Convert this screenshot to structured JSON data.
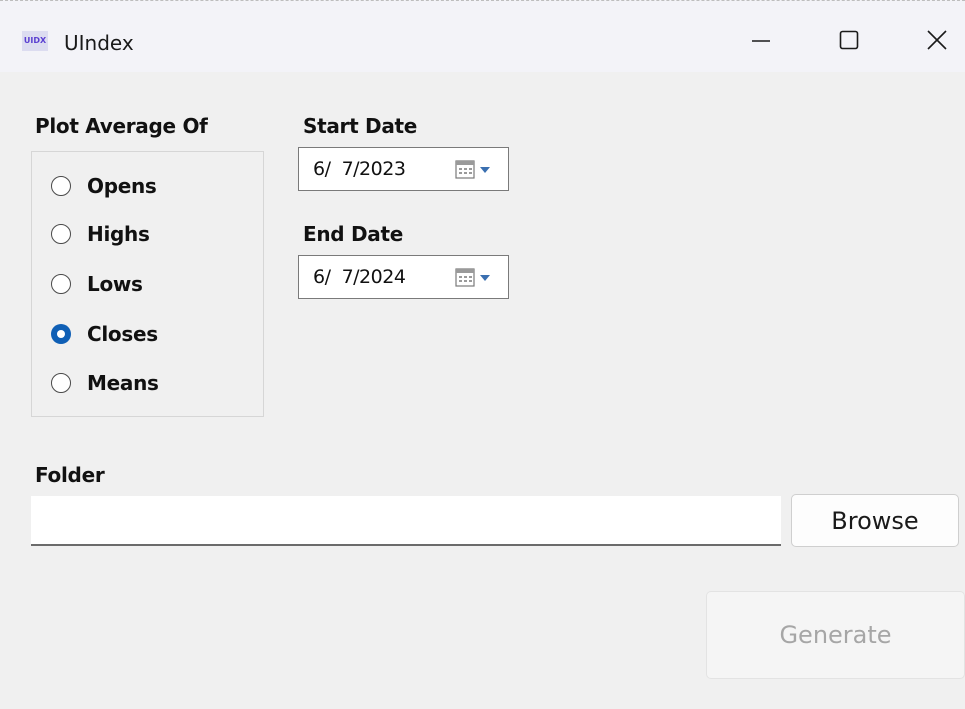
{
  "window": {
    "app_icon_text": "UIDX",
    "title": "UIndex",
    "icons": {
      "minimize": "minimize-icon",
      "maximize": "maximize-icon",
      "close": "close-icon"
    }
  },
  "plot_group": {
    "label": "Plot Average Of",
    "options": [
      {
        "label": "Opens",
        "checked": false
      },
      {
        "label": "Highs",
        "checked": false
      },
      {
        "label": "Lows",
        "checked": false
      },
      {
        "label": "Closes",
        "checked": true
      },
      {
        "label": "Means",
        "checked": false
      }
    ],
    "accent_color": "#0f5fb5"
  },
  "start_date": {
    "label": "Start Date",
    "value": "6/  7/2023"
  },
  "end_date": {
    "label": "End Date",
    "value": "6/  7/2024"
  },
  "folder": {
    "label": "Folder",
    "value": "",
    "browse_label": "Browse"
  },
  "generate": {
    "label": "Generate",
    "enabled": false
  }
}
